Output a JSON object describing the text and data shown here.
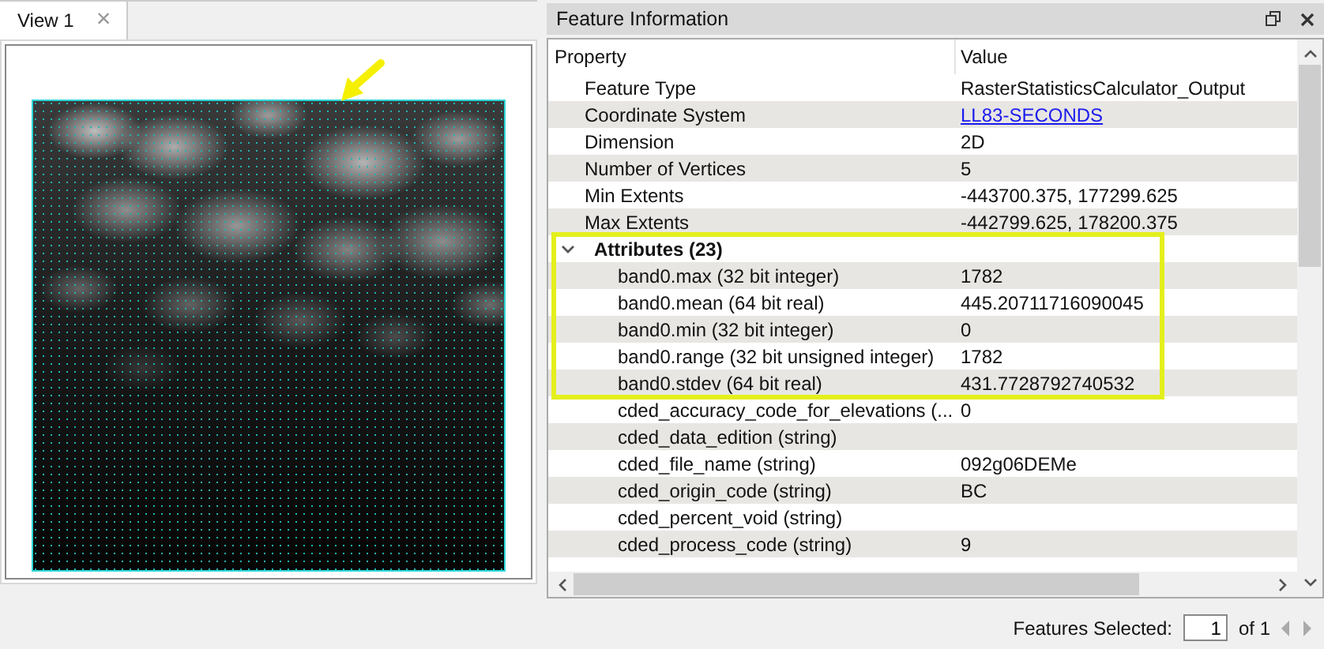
{
  "view_tabs": [
    {
      "label": "View 1",
      "selected": true,
      "close": "×"
    }
  ],
  "feature_panel": {
    "title": "Feature Information",
    "columns": [
      "Property",
      "Value"
    ],
    "rows": [
      {
        "kind": "property",
        "property": "Feature Type",
        "value": "RasterStatisticsCalculator_Output",
        "highlighted": false
      },
      {
        "kind": "property",
        "property": "Coordinate System",
        "value": "LL83-SECONDS",
        "link": true,
        "highlighted": false
      },
      {
        "kind": "property",
        "property": "Dimension",
        "value": "2D",
        "highlighted": false
      },
      {
        "kind": "property",
        "property": "Number of Vertices",
        "value": "5",
        "highlighted": false
      },
      {
        "kind": "property",
        "property": "Min Extents",
        "value": "-443700.375, 177299.625",
        "highlighted": false
      },
      {
        "kind": "property",
        "property": "Max Extents",
        "value": "-442799.625, 178200.375",
        "highlighted": false
      },
      {
        "kind": "group",
        "property": "Attributes (23)",
        "expanded": true,
        "highlighted": true
      },
      {
        "kind": "attribute",
        "property": "band0.max (32 bit integer)",
        "value": "1782",
        "highlighted": true
      },
      {
        "kind": "attribute",
        "property": "band0.mean (64 bit real)",
        "value": "445.20711716090045",
        "highlighted": true
      },
      {
        "kind": "attribute",
        "property": "band0.min (32 bit integer)",
        "value": "0",
        "highlighted": true
      },
      {
        "kind": "attribute",
        "property": "band0.range (32 bit unsigned integer)",
        "value": "1782",
        "highlighted": true
      },
      {
        "kind": "attribute",
        "property": "band0.stdev (64 bit real)",
        "value": "431.7728792740532",
        "highlighted": true
      },
      {
        "kind": "attribute",
        "property": "cded_accuracy_code_for_elevations (...",
        "value": "0",
        "highlighted": false
      },
      {
        "kind": "attribute",
        "property": "cded_data_edition (string)",
        "highlighted": false
      },
      {
        "kind": "attribute",
        "property": "cded_file_name (string)",
        "value": "092g06DEMe",
        "highlighted": false
      },
      {
        "kind": "attribute",
        "property": "cded_origin_code (string)",
        "value": "BC",
        "highlighted": false
      },
      {
        "kind": "attribute",
        "property": "cded_percent_void (string)",
        "highlighted": false
      },
      {
        "kind": "attribute",
        "property": "cded_process_code (string)",
        "value": "9",
        "highlighted": false
      }
    ],
    "footer": {
      "label": "Features Selected:",
      "current": "1",
      "total": "of 1"
    }
  }
}
